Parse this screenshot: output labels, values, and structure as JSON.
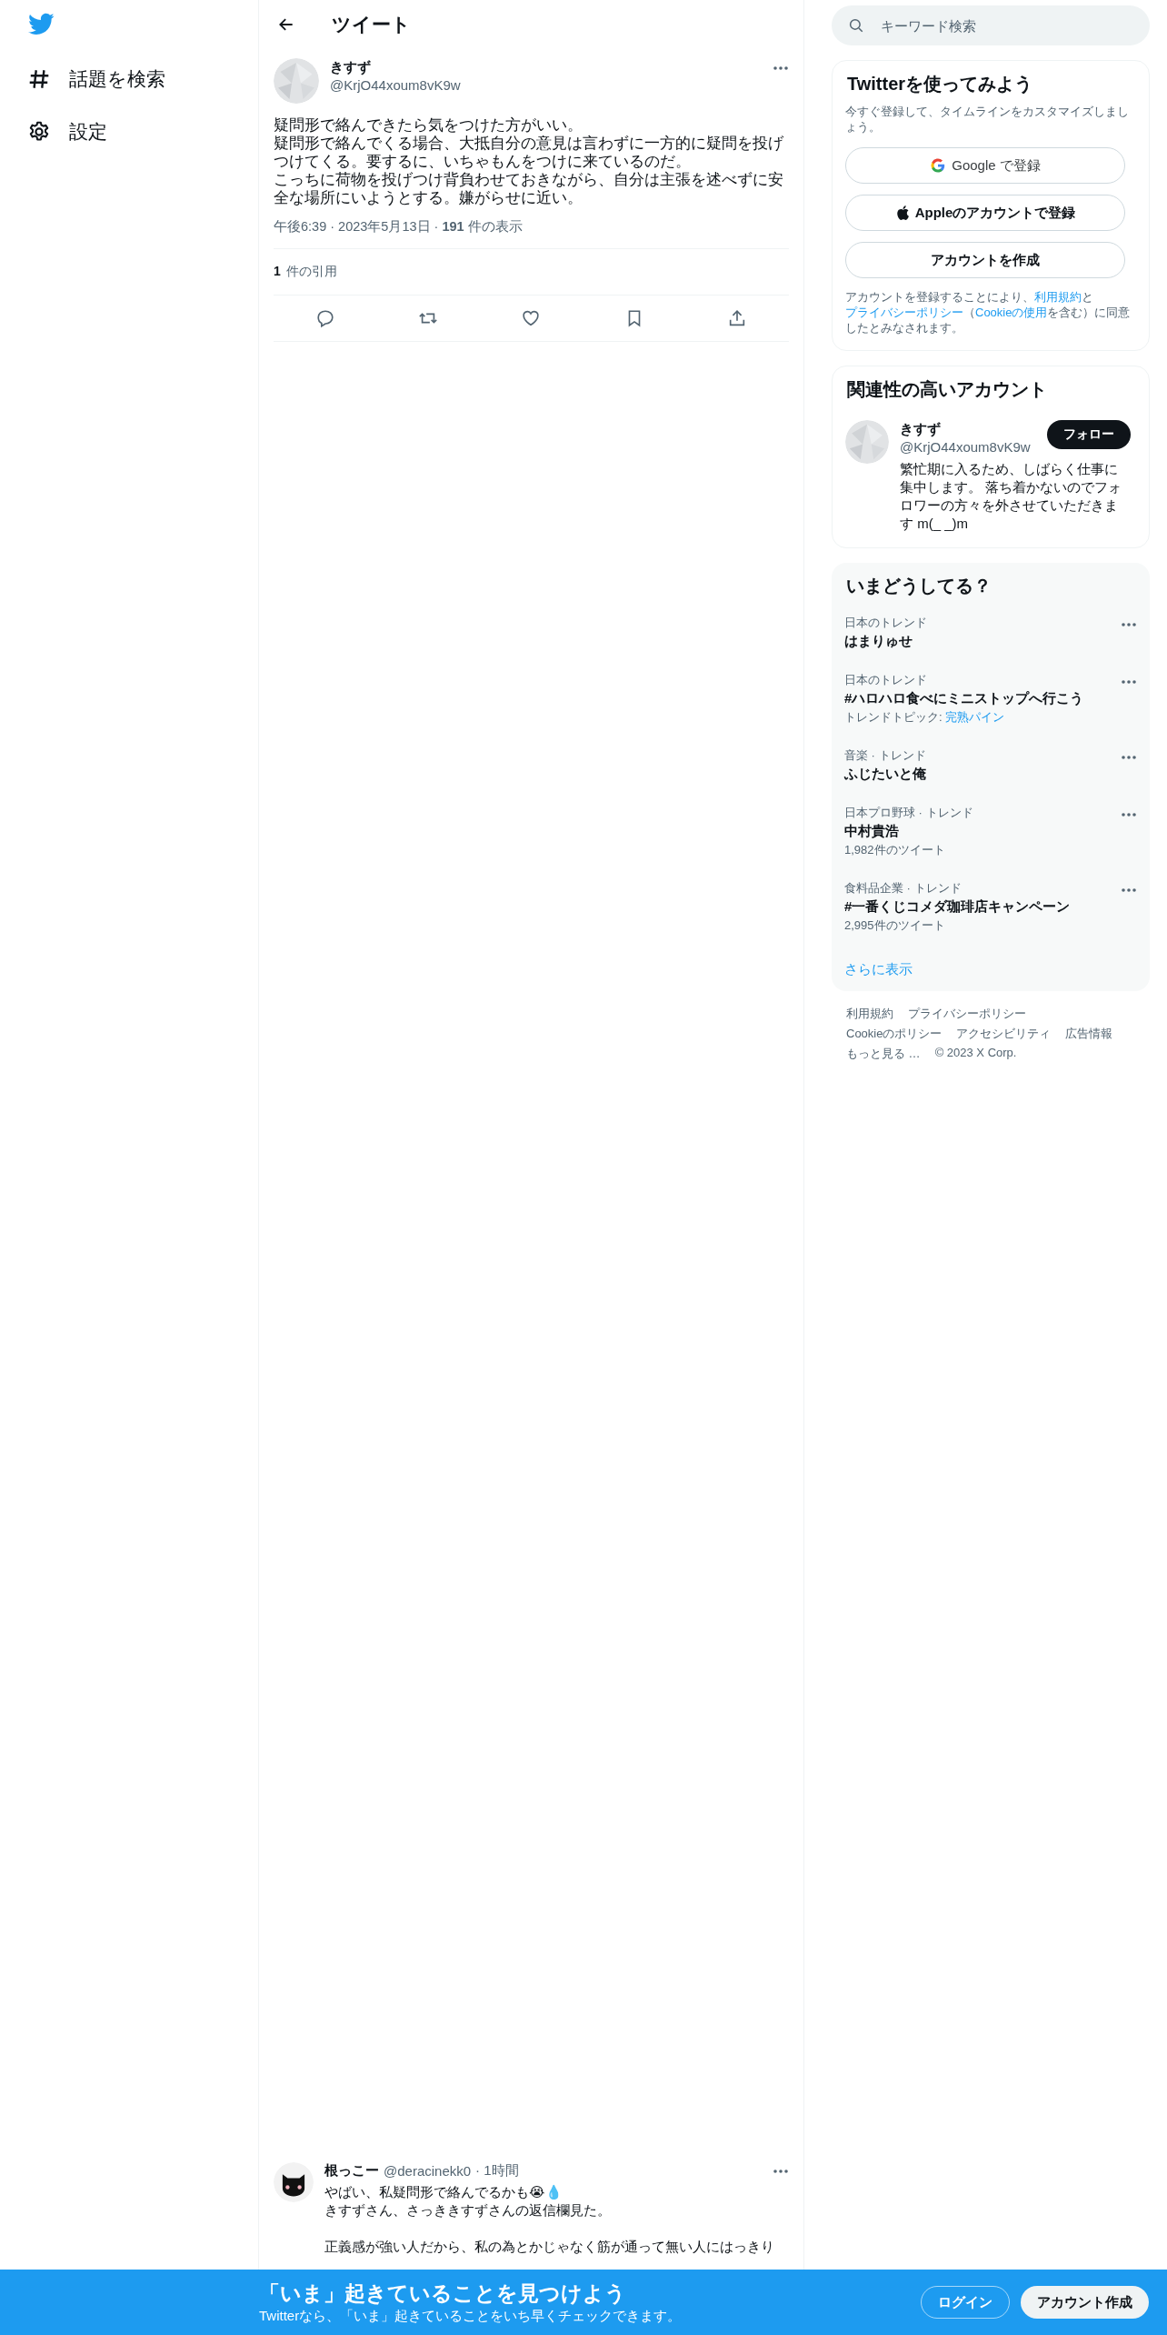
{
  "sidebar": {
    "items": [
      {
        "kind": "explore",
        "label": "話題を検索"
      },
      {
        "kind": "settings",
        "label": "設定"
      }
    ]
  },
  "header": {
    "title": "ツイート"
  },
  "tweet": {
    "name": "きすず",
    "handle": "@KrjO44xoum8vK9w",
    "paragraphs": [
      "疑問形で絡んできたら気をつけた方がいい。",
      "疑問形で絡んでくる場合、大抵自分の意見は言わずに一方的に疑問を投げつけてくる。要するに、いちゃもんをつけに来ているのだ。",
      "こっちに荷物を投げつけ背負わせておきながら、自分は主張を述べずに安全な場所にいようとする。嫌がらせに近い。"
    ],
    "meta": "午後6:39 · 2023年5月13日 · **191** 件の表示",
    "quotes_count": "1",
    "quotes_label": "件の引用"
  },
  "reply": {
    "name": "根っこー",
    "handle": "@deracinekk0",
    "time": "· 1時間",
    "paragraphs": [
      [
        "やばい、私疑問形で絡んでるかも😭💧",
        "きすずさん、さっききすずさんの返信欄見た。"
      ],
      [
        "正義感が強い人だから、私の為とかじゃなく筋が通って無い人にはっきり"
      ]
    ]
  },
  "search": {
    "placeholder": "キーワード検索"
  },
  "signup_card": {
    "title": "Twitterを使ってみよう",
    "subtitle": "今すぐ登録して、タイムラインをカスタマイズしましょう。",
    "buttons": [
      {
        "kind": "google",
        "label": "Google で登録"
      },
      {
        "kind": "apple",
        "label": "Appleのアカウントで登録"
      },
      {
        "kind": "plain",
        "label": "アカウントを作成"
      }
    ],
    "legal": [
      {
        "text": "アカウントを登録することにより、",
        "link": false
      },
      {
        "text": "利用規約",
        "link": true
      },
      {
        "text": "と",
        "link": false
      },
      {
        "text": "プライバシーポリシー",
        "link": true
      },
      {
        "text": "（",
        "link": false
      },
      {
        "text": "Cookieの使用",
        "link": true
      },
      {
        "text": "を含む）に同意したとみなされます。",
        "link": false
      }
    ]
  },
  "related": {
    "title": "関連性の高いアカウント",
    "name": "きすず",
    "handle": "@KrjO44xoum8vK9w",
    "follow": "フォロー",
    "bio": "繁忙期に入るため、しばらく仕事に集中します。 落ち着かないのでフォロワーの方々を外させていただきます m(_ _)m"
  },
  "trends": {
    "title": "いまどうしてる？",
    "items": [
      {
        "category": "日本のトレンド",
        "title": "はまりゅせ"
      },
      {
        "category": "日本のトレンド",
        "title": "#ハロハロ食べにミニストップへ行こう",
        "meta": "トレンドトピック: ",
        "meta_link": "完熟パイン"
      },
      {
        "category": "音楽 · トレンド",
        "title": "ふじたいと俺"
      },
      {
        "category": "日本プロ野球 · トレンド",
        "title": "中村貴浩",
        "meta": "1,982件のツイート"
      },
      {
        "category": "食料品企業 · トレンド",
        "title": "#一番くじコメダ珈琲店キャンペーン",
        "meta": "2,995件のツイート"
      }
    ],
    "more": "さらに表示"
  },
  "footer": {
    "links": [
      "利用規約",
      "プライバシーポリシー",
      "Cookieのポリシー",
      "アクセシビリティ",
      "広告情報",
      "もっと見る …"
    ],
    "copyright": "© 2023 X Corp."
  },
  "bottom_bar": {
    "title": "「いま」起きていることを見つけよう",
    "subtitle": "Twitterなら、「いま」起きていることをいち早くチェックできます。",
    "login": "ログイン",
    "signup": "アカウント作成"
  }
}
